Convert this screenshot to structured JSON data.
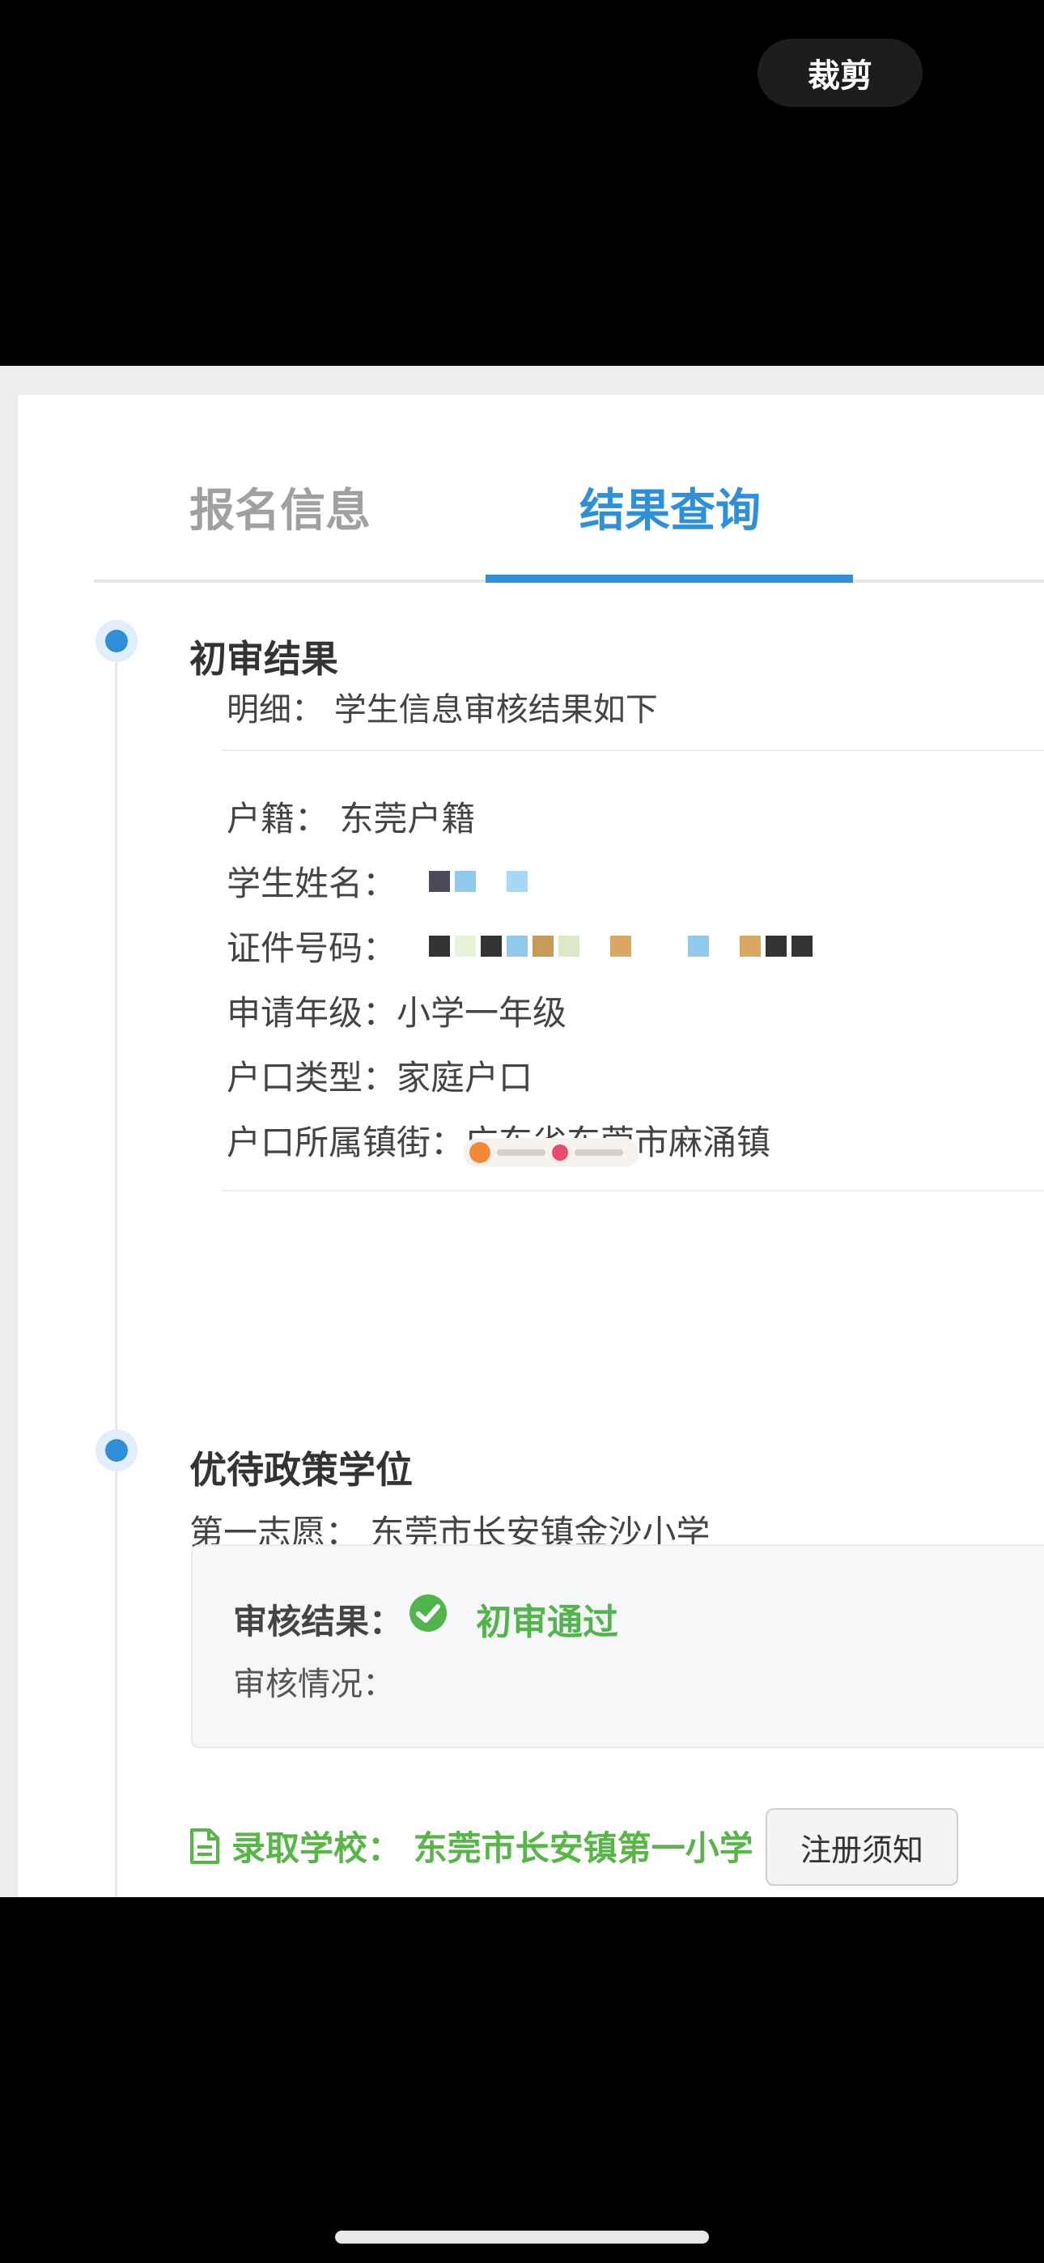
{
  "header": {
    "crop_label": "裁剪"
  },
  "tabs": [
    {
      "label": "报名信息",
      "active": false
    },
    {
      "label": "结果查询",
      "active": true
    }
  ],
  "initial_review": {
    "title": "初审结果",
    "detail_line": "明细： 学生信息审核结果如下",
    "fields": {
      "household": "户籍： 东莞户籍",
      "student_name_label": "学生姓名：",
      "id_label": "证件号码：",
      "grade": "申请年级：小学一年级",
      "hukou_type": "户口类型：家庭户口",
      "hukou_town": "户口所属镇街：广东省东莞市麻涌镇"
    }
  },
  "policy_section": {
    "title": "优待政策学位",
    "first_choice": "第一志愿： 东莞市长安镇金沙小学",
    "result_label": "审核结果：",
    "result_value": "初审通过",
    "status_label": "审核情况：",
    "admitted_school": "录取学校： 东莞市长安镇第一小学",
    "notice_button": "注册须知"
  },
  "colors": {
    "accent": "#2f8fd9",
    "success": "#52b54b",
    "admit": "#58b548"
  },
  "icons": [
    "check-circle-icon",
    "document-icon"
  ]
}
